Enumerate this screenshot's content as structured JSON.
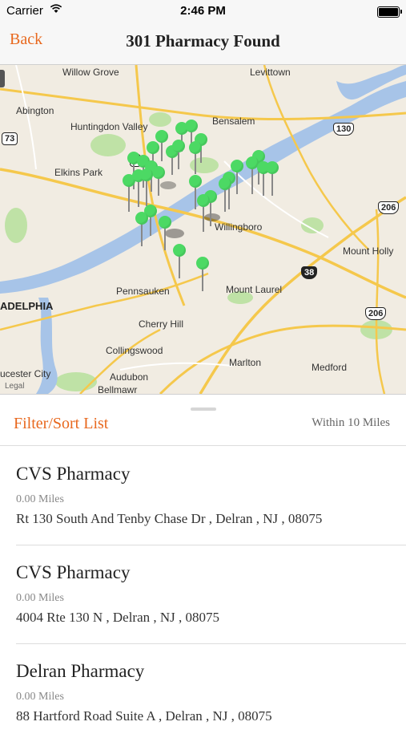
{
  "status_bar": {
    "carrier": "Carrier",
    "wifi_icon": "wifi-icon",
    "time": "2:46 PM",
    "battery_icon": "battery-icon"
  },
  "nav": {
    "back_label": "Back",
    "title": "301 Pharmacy Found"
  },
  "map": {
    "labels": {
      "willow_grove": "Willow Grove",
      "levittown": "Levittown",
      "abington": "Abington",
      "huntingdon_valley": "Huntingdon Valley",
      "bensalem": "Bensalem",
      "elkins_park": "Elkins Park",
      "willingboro": "Willingboro",
      "mount_holly": "Mount Holly",
      "pennsauken": "Pennsauken",
      "mount_laurel": "Mount Laurel",
      "philadelphia": "ADELPHIA",
      "cherry_hill": "Cherry Hill",
      "collingswood": "Collingswood",
      "marlton": "Marlton",
      "medford": "Medford",
      "audubon": "Audubon",
      "bellmawr": "Bellmawr",
      "gloucester_city": "ucester City",
      "legal": "Legal"
    },
    "shields": {
      "r73": "73",
      "r1": "1",
      "r130": "130",
      "r206a": "206",
      "r38": "38",
      "r206b": "206"
    },
    "pin_color": "#4cd964",
    "water_color": "#a7c4e8",
    "park_color": "#bfe2a6",
    "road_color": "#f5c84c"
  },
  "list_header": {
    "filter_label": "Filter/Sort List",
    "radius_label": "Within 10 Miles"
  },
  "pharmacies": [
    {
      "name": "CVS Pharmacy",
      "distance": "0.00 Miles",
      "address": "Rt 130 South And Tenby Chase Dr , Delran , NJ , 08075"
    },
    {
      "name": "CVS Pharmacy",
      "distance": "0.00 Miles",
      "address": "4004 Rte 130 N , Delran , NJ , 08075"
    },
    {
      "name": "Delran Pharmacy",
      "distance": "0.00 Miles",
      "address": "88 Hartford Road Suite A , Delran , NJ , 08075"
    }
  ],
  "accent_color": "#e8681e"
}
